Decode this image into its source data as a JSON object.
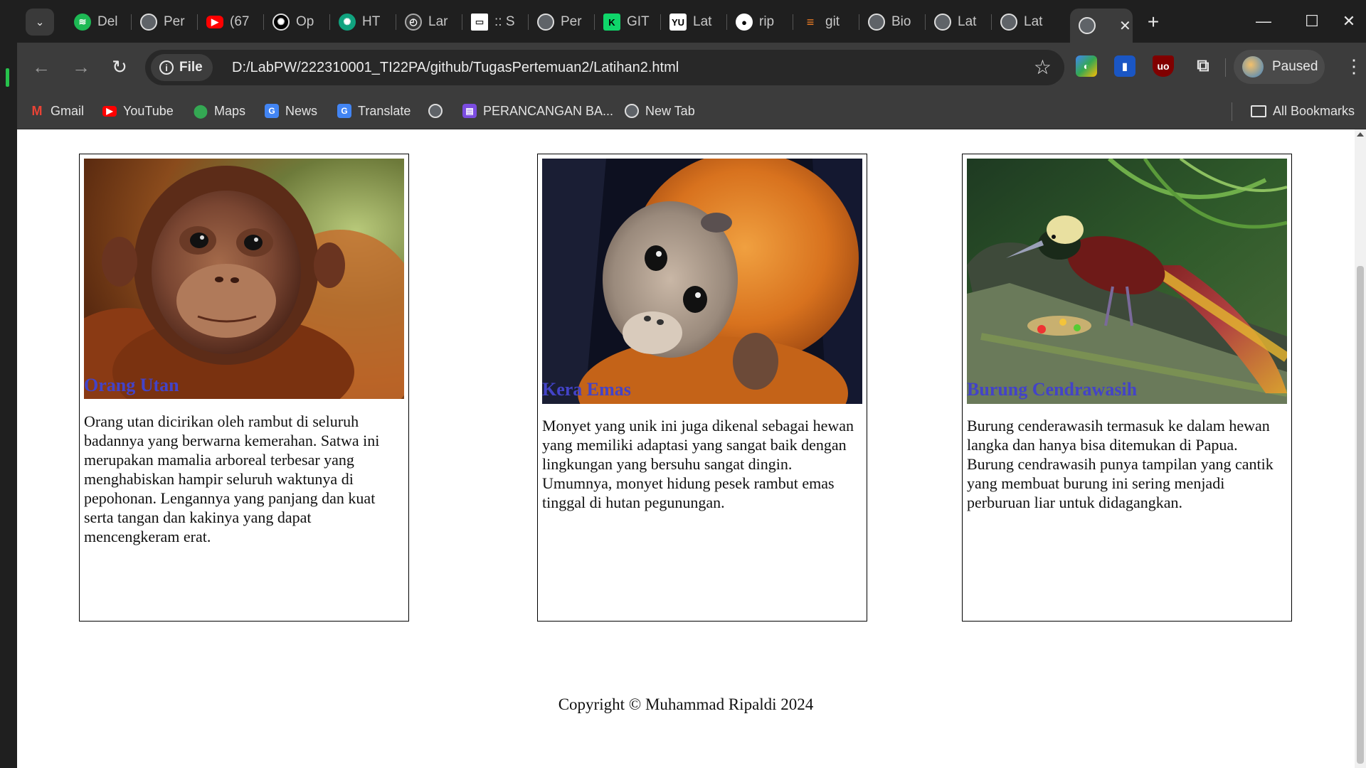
{
  "tabs": [
    {
      "label": "Del",
      "icon": "spotify-icon"
    },
    {
      "label": "Per",
      "icon": "globe-icon"
    },
    {
      "label": "(67",
      "icon": "youtube-icon"
    },
    {
      "label": "Op",
      "icon": "openai-icon"
    },
    {
      "label": "HT",
      "icon": "chatgpt-icon"
    },
    {
      "label": "Lar",
      "icon": "laravel-icon"
    },
    {
      "label": ":: S",
      "icon": "page-icon"
    },
    {
      "label": "Per",
      "icon": "globe-icon"
    },
    {
      "label": "GIT",
      "icon": "gitkraken-icon"
    },
    {
      "label": "Lat",
      "icon": "yu-icon"
    },
    {
      "label": "rip",
      "icon": "github-icon"
    },
    {
      "label": "git",
      "icon": "stackoverflow-icon"
    },
    {
      "label": "Bio",
      "icon": "globe-icon"
    },
    {
      "label": "Lat",
      "icon": "globe-icon"
    },
    {
      "label": "Lat",
      "icon": "globe-icon"
    },
    {
      "label": "",
      "icon": "globe-icon",
      "active": true
    }
  ],
  "tab_close_glyph": "✕",
  "toolbar": {
    "scheme_label": "File",
    "url": "D:/LabPW/222310001_TI22PA/github/TugasPertemuan2/Latihan2.html",
    "profile_label": "Paused"
  },
  "bookmarks": {
    "items": [
      {
        "label": "Gmail",
        "icon": "gmail-icon"
      },
      {
        "label": "YouTube",
        "icon": "youtube-icon"
      },
      {
        "label": "Maps",
        "icon": "maps-icon"
      },
      {
        "label": "News",
        "icon": "news-icon"
      },
      {
        "label": "Translate",
        "icon": "translate-icon"
      },
      {
        "label": "",
        "icon": "globe-icon"
      },
      {
        "label": "PERANCANGAN BA...",
        "icon": "forms-icon"
      },
      {
        "label": "New Tab",
        "icon": "globe-icon"
      }
    ],
    "all_label": "All Bookmarks"
  },
  "cards": [
    {
      "title": "Orang Utan",
      "image": "orangutan-photo",
      "text": "Orang utan dicirikan oleh rambut di seluruh badannya yang berwarna kemerahan. Satwa ini merupakan mamalia arboreal terbesar yang menghabiskan hampir seluruh waktunya di pepohonan. Lengannya yang panjang dan kuat serta tangan dan kakinya yang dapat mencengkeram erat."
    },
    {
      "title": "Kera Emas",
      "image": "golden-monkey-photo",
      "text": "Monyet yang unik ini juga dikenal sebagai hewan yang memiliki adaptasi yang sangat baik dengan lingkungan yang bersuhu sangat dingin. Umumnya, monyet hidung pesek rambut emas tinggal di hutan pegunungan."
    },
    {
      "title": "Burung Cendrawasih",
      "image": "bird-of-paradise-photo",
      "text": "Burung cenderawasih termasuk ke dalam hewan langka dan hanya bisa ditemukan di Papua. Burung cendrawasih punya tampilan yang cantik yang membuat burung ini sering menjadi perburuan liar untuk didagangkan."
    }
  ],
  "footer": "Copyright © Muhammad Ripaldi 2024",
  "colors": {
    "card_title": "#4343c8",
    "chrome_dark": "#1f1f1f",
    "chrome_toolbar": "#3c3c3c"
  }
}
